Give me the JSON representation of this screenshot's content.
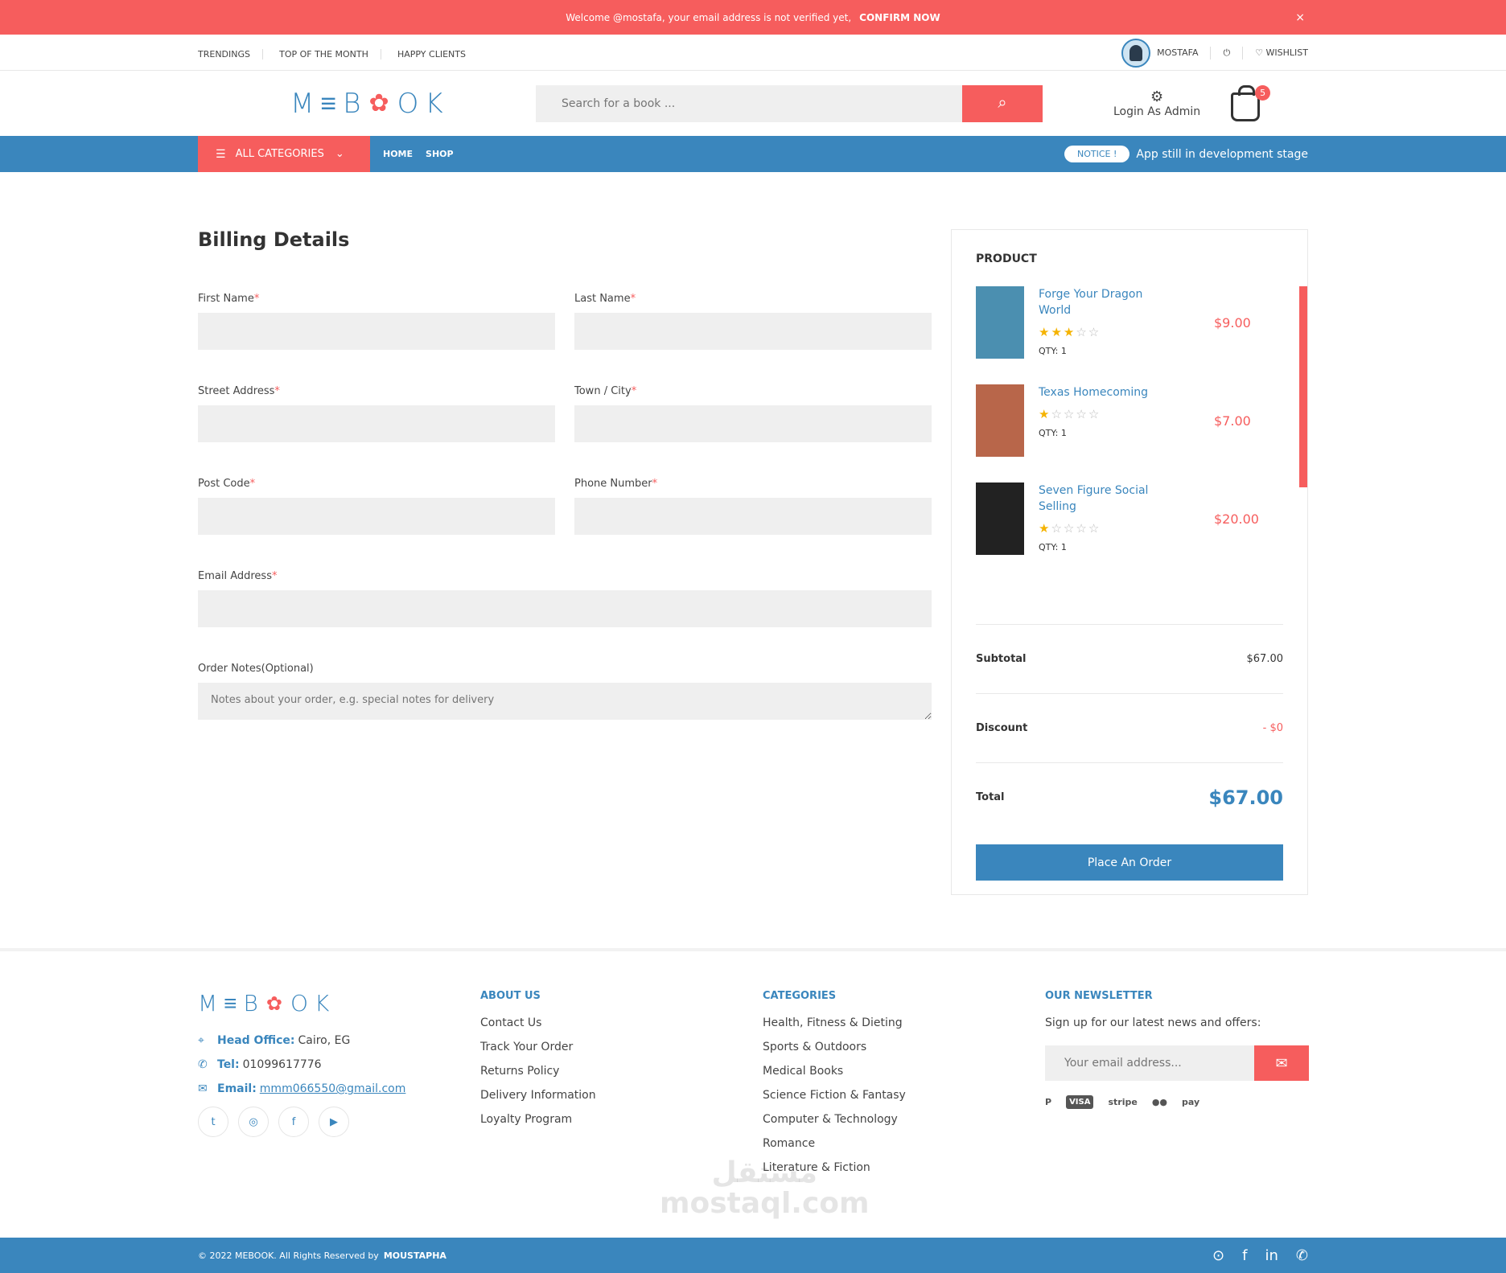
{
  "alert": {
    "message": "Welcome @mostafa, your email address is not verified yet,",
    "action": "CONFIRM NOW",
    "close": "×"
  },
  "toplinks": [
    "TRENDINGS",
    "TOP OF THE MONTH",
    "HAPPY CLIENTS"
  ],
  "user": {
    "name": "MOSTAFA",
    "power": "⏻",
    "wishlist": "WISHLIST"
  },
  "header": {
    "logo_a": "M",
    "logo_b": "≡",
    "logo_c": "B",
    "logo_d": "OK",
    "search_placeholder": "Search for a book ...",
    "admin_label": "Login As Admin",
    "cart_count": "5"
  },
  "nav": {
    "categories": "ALL CATEGORIES",
    "home": "HOME",
    "shop": "SHOP",
    "notice_pill": "NOTICE !",
    "notice_text": "App still in development stage"
  },
  "billing": {
    "title": "Billing Details",
    "first_name": "First Name",
    "last_name": "Last Name",
    "street": "Street Address",
    "town": "Town / City",
    "post": "Post Code",
    "phone": "Phone Number",
    "email": "Email Address",
    "notes": "Order Notes(Optional)",
    "notes_placeholder": "Notes about your order, e.g. special notes for delivery",
    "required": "*"
  },
  "order": {
    "header": "PRODUCT",
    "items": [
      {
        "name": "Forge Your Dragon World",
        "rating": 3,
        "qty": "QTY: 1",
        "price": "$9.00",
        "cover_color": "#4b8fb0"
      },
      {
        "name": "Texas Homecoming",
        "rating": 1,
        "qty": "QTY: 1",
        "price": "$7.00",
        "cover_color": "#b8664a"
      },
      {
        "name": "Seven Figure Social Selling",
        "rating": 1,
        "qty": "QTY: 1",
        "price": "$20.00",
        "cover_color": "#222222"
      }
    ],
    "subtotal_label": "Subtotal",
    "subtotal": "$67.00",
    "discount_label": "Discount",
    "discount": "- $0",
    "total_label": "Total",
    "total": "$67.00",
    "place_order": "Place An Order"
  },
  "footer": {
    "office_label": "Head Office:",
    "office": "Cairo, EG",
    "tel_label": "Tel:",
    "tel": "01099617776",
    "email_label": "Email:",
    "email": "mmm066550@gmail.com",
    "about_title": "ABOUT US",
    "about": [
      "Contact Us",
      "Track Your Order",
      "Returns Policy",
      "Delivery Information",
      "Loyalty Program"
    ],
    "categories_title": "CATEGORIES",
    "categories": [
      "Health, Fitness & Dieting",
      "Sports & Outdoors",
      "Medical Books",
      "Science Fiction & Fantasy",
      "Computer & Technology",
      "Romance",
      "Literature & Fiction"
    ],
    "newsletter_title": "OUR NEWSLETTER",
    "newsletter_text": "Sign up for our latest news and offers:",
    "newsletter_placeholder": "Your email address...",
    "payments": [
      "P",
      "VISA",
      "stripe",
      "●●",
      "pay"
    ]
  },
  "watermark": {
    "line1": "مستقل",
    "line2": "mostaql.com"
  },
  "bottom": {
    "copy": "© 2022 MEBOOK. All Rights Reserved by",
    "author": "MOUSTAPHA"
  },
  "colors": {
    "accent": "#f65d5d",
    "brand": "#3a86bd"
  }
}
